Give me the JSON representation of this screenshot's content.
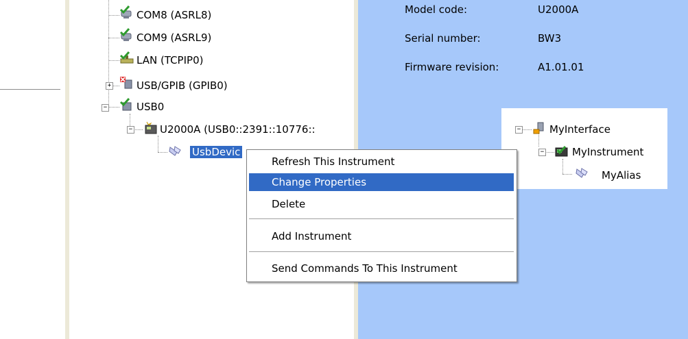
{
  "tree": {
    "com8": "COM8 (ASRL8)",
    "com9": "COM9 (ASRL9)",
    "lan": "LAN (TCPIP0)",
    "usbgpib": "USB/GPIB (GPIB0)",
    "usb0": "USB0",
    "u2000a": "U2000A (USB0::2391::10776::",
    "usbdevice": "UsbDevic"
  },
  "info": {
    "model_label": "Model code:",
    "model_value": "U2000A",
    "serial_label": "Serial number:",
    "serial_value": "BW3",
    "firmware_label": "Firmware revision:",
    "firmware_value": "A1.01.01"
  },
  "mini_tree": {
    "interface": "MyInterface",
    "instrument": "MyInstrument",
    "alias": "MyAlias"
  },
  "context_menu": {
    "items": [
      "Refresh This Instrument",
      "Change Properties",
      "Delete",
      "Add Instrument",
      "Send Commands To This Instrument"
    ],
    "highlighted": "Change Properties"
  }
}
